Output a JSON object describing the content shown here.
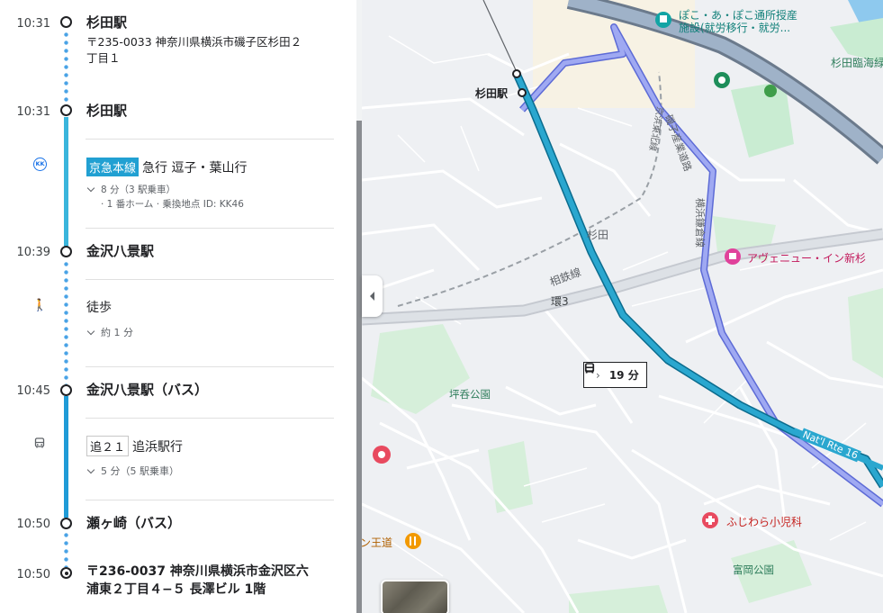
{
  "itinerary": {
    "origin": {
      "time": "10:31",
      "name": "杉田駅",
      "address_line1": "〒235-0033 神奈川県横浜市磯子区杉田２",
      "address_line2": "丁目１"
    },
    "board": {
      "time": "10:31",
      "name": "杉田駅"
    },
    "train_leg": {
      "operator_icon": "KK",
      "line_name": "京急本線",
      "service": "急行 逗子・葉山行",
      "duration": "8 分（3 駅乗車）",
      "detail": "· 1 番ホーム · 乗換地点 ID: KK46",
      "line_color": "#21a0d2"
    },
    "transfer_stop": {
      "time": "10:39",
      "name": "金沢八景駅"
    },
    "walk_leg": {
      "icon": "walk-icon",
      "label": "徒歩",
      "duration": "約 1 分"
    },
    "bus_stop": {
      "time": "10:45",
      "name": "金沢八景駅（バス）"
    },
    "bus_leg": {
      "icon": "bus-icon",
      "route": "追２１",
      "destination": "追浜駅行",
      "duration": "5 分（5 駅乗車）",
      "line_color": "#1f9bd7"
    },
    "alight_stop": {
      "time": "10:50",
      "name": "瀬ヶ崎（バス）"
    },
    "destination": {
      "time": "10:50",
      "address_line1": "〒236-0037 神奈川県横浜市金沢区六",
      "address_line2": "浦東２丁目４−５ 長澤ビル 1階"
    }
  },
  "map": {
    "station_label": "杉田駅",
    "area_sugita": "杉田",
    "line_label": "相鉄線",
    "ring_road": "環3",
    "park_tsubone": "坪呑公園",
    "park_tomioka": "富岡公園",
    "road_negishi": "磯子産業道路",
    "road_yokohama": "横浜鎌倉線",
    "road_keihin": "京浜東北線",
    "route16": "Nat'l Rte 16",
    "coast_label": "杉田臨海緑",
    "poi_top": "ぽこ・あ・ぽこ通所授産",
    "poi_top2": "施設(就労移行・就労...",
    "poi_hotel": "アヴェニュー・イン新杉",
    "poi_clinic": "ふじわら小児科",
    "poi_restaurant": "ン王道",
    "route_chip_time": "19 分",
    "colors": {
      "route_main": "#2aa7cf",
      "route_alt": "#8f9df0",
      "water": "#8ec9ee",
      "park": "#c9ecd2"
    }
  }
}
